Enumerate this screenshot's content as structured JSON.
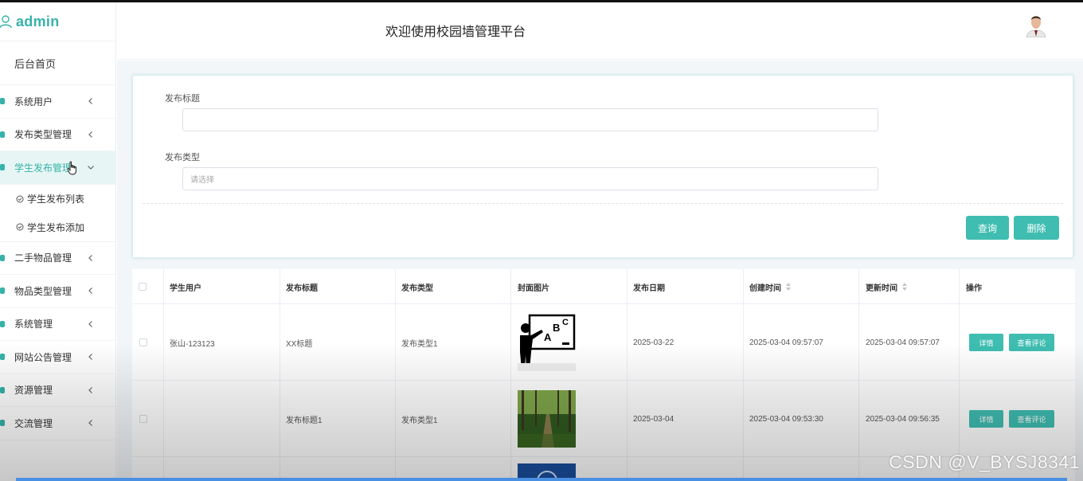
{
  "brand": {
    "name": "admin",
    "icon": "user-outline-icon"
  },
  "header": {
    "title": "欢迎使用校园墙管理平台",
    "avatar": "user-avatar"
  },
  "sidebar": {
    "home": "后台首页",
    "items": [
      {
        "label": "系统用户"
      },
      {
        "label": "发布类型管理"
      },
      {
        "label": "学生发布管理",
        "active": true
      },
      {
        "label": "二手物品管理"
      },
      {
        "label": "物品类型管理"
      },
      {
        "label": "系统管理"
      },
      {
        "label": "网站公告管理"
      },
      {
        "label": "资源管理"
      },
      {
        "label": "交流管理"
      }
    ],
    "submenu": [
      {
        "label": "学生发布列表"
      },
      {
        "label": "学生发布添加"
      }
    ]
  },
  "search": {
    "title_label": "发布标题",
    "title_value": "",
    "type_label": "发布类型",
    "type_placeholder": "请选择",
    "query_button": "查询",
    "delete_button": "删除"
  },
  "table": {
    "headers": [
      "学生用户",
      "发布标题",
      "发布类型",
      "封面图片",
      "发布日期",
      "创建时间",
      "更新时间",
      "操作"
    ],
    "rows": [
      {
        "user": "张山-123123",
        "title": "XX标题",
        "type": "发布类型1",
        "image": "teacher-blackboard-image",
        "date": "2025-03-22",
        "created": "2025-03-04 09:57:07",
        "updated": "2025-03-04 09:57:07"
      },
      {
        "user": "",
        "title": "发布标题1",
        "type": "发布类型1",
        "image": "forest-path-image",
        "date": "2025-03-04",
        "created": "2025-03-04 09:53:30",
        "updated": "2025-03-04 09:56:35"
      }
    ],
    "actions": {
      "detail": "详情",
      "comments": "查看评论"
    }
  },
  "watermark": "CSDN @V_BYSJ8341",
  "colors": {
    "accent": "#3fbdb1",
    "brand": "#35b2a9"
  }
}
